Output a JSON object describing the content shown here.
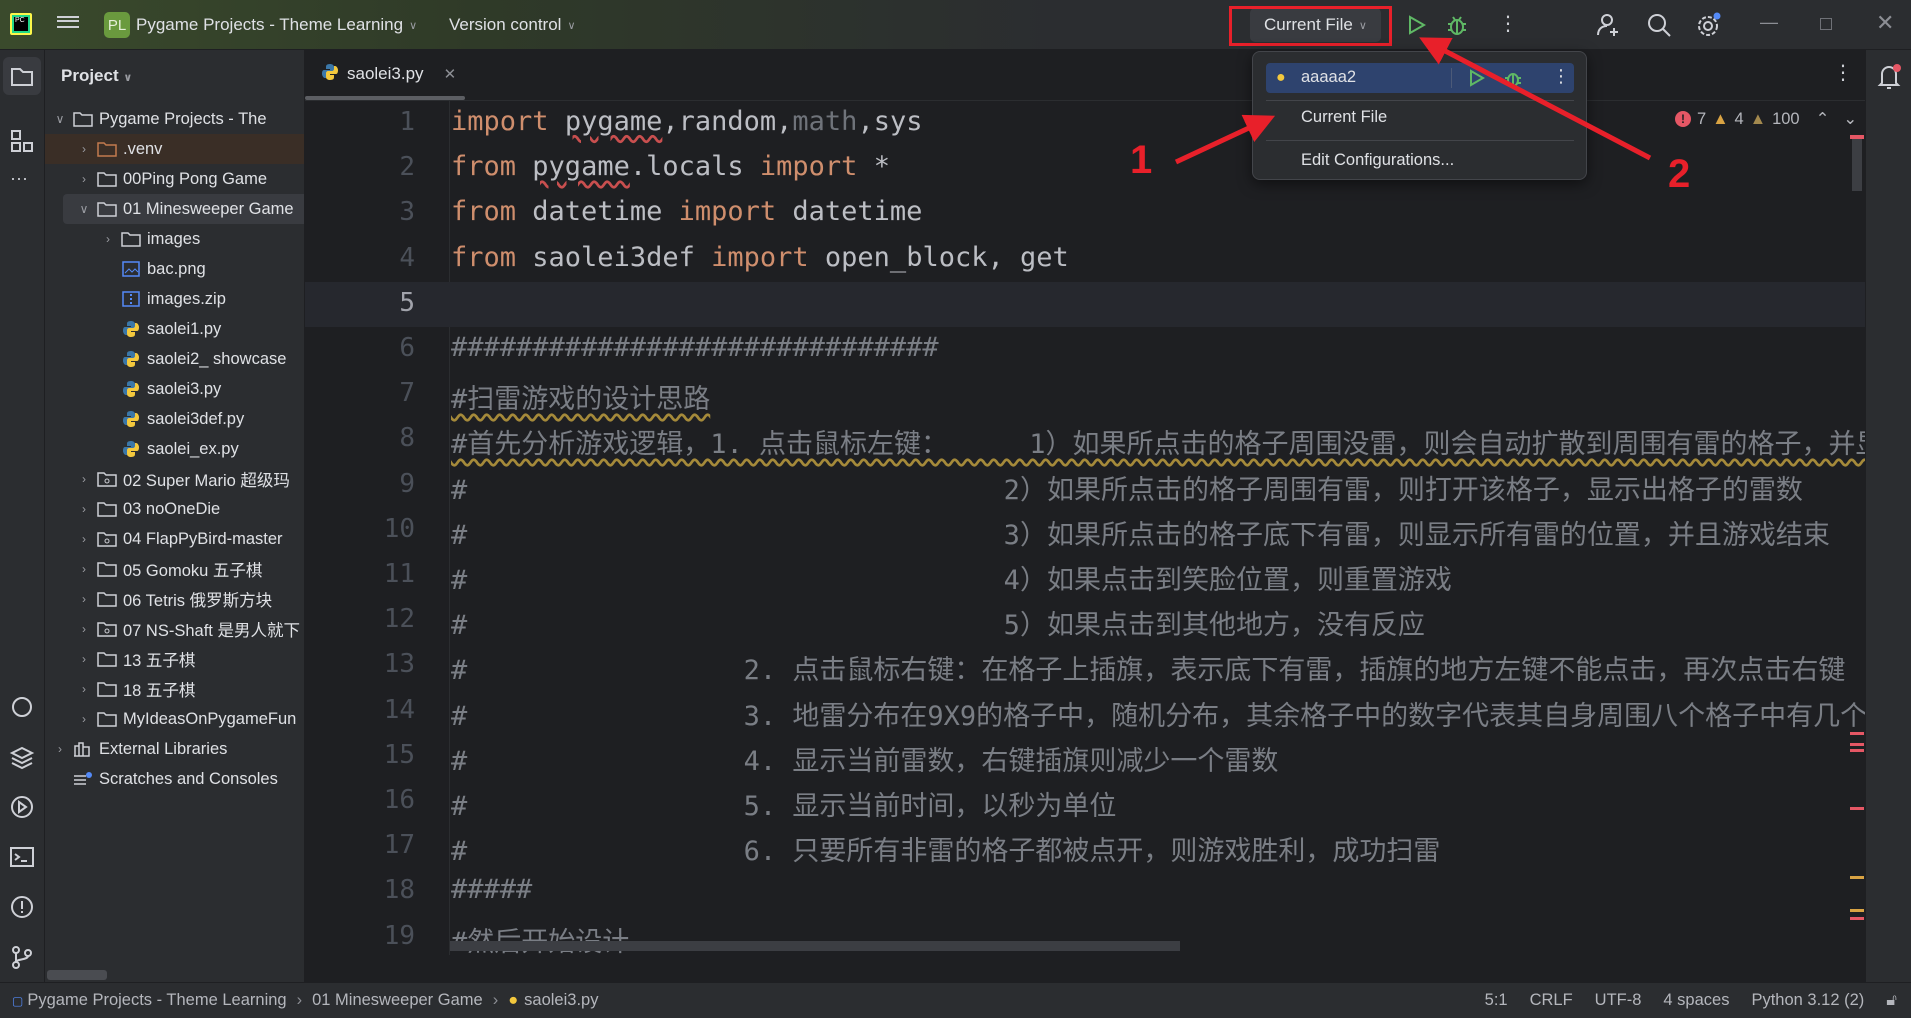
{
  "titlebar": {
    "project_badge": "PL",
    "project_name": "Pygame Projects - Theme Learning",
    "vcs": "Version control",
    "run_config": "Current File"
  },
  "project_panel": {
    "title": "Project",
    "items": [
      {
        "label": "Pygame Projects - The",
        "depth": 0,
        "arrow": "open",
        "icon": "folder"
      },
      {
        "label": ".venv",
        "depth": 1,
        "arrow": "closed",
        "icon": "folder-excluded"
      },
      {
        "label": "00Ping Pong Game",
        "depth": 1,
        "arrow": "closed",
        "icon": "folder"
      },
      {
        "label": "01 Minesweeper Game",
        "depth": 1,
        "arrow": "open",
        "icon": "folder",
        "selected": true
      },
      {
        "label": "images",
        "depth": 2,
        "arrow": "closed",
        "icon": "folder"
      },
      {
        "label": "bac.png",
        "depth": 2,
        "icon": "image"
      },
      {
        "label": "images.zip",
        "depth": 2,
        "icon": "archive"
      },
      {
        "label": "saolei1.py",
        "depth": 2,
        "icon": "python"
      },
      {
        "label": "saolei2_ showcase",
        "depth": 2,
        "icon": "python"
      },
      {
        "label": "saolei3.py",
        "depth": 2,
        "icon": "python"
      },
      {
        "label": "saolei3def.py",
        "depth": 2,
        "icon": "python"
      },
      {
        "label": "saolei_ex.py",
        "depth": 2,
        "icon": "python"
      },
      {
        "label": "02 Super Mario 超级玛",
        "depth": 1,
        "arrow": "closed",
        "icon": "folder-module"
      },
      {
        "label": "03 noOneDie",
        "depth": 1,
        "arrow": "closed",
        "icon": "folder"
      },
      {
        "label": "04 FlapPyBird-master",
        "depth": 1,
        "arrow": "closed",
        "icon": "folder-module"
      },
      {
        "label": "05 Gomoku 五子棋",
        "depth": 1,
        "arrow": "closed",
        "icon": "folder"
      },
      {
        "label": "06 Tetris 俄罗斯方块",
        "depth": 1,
        "arrow": "closed",
        "icon": "folder"
      },
      {
        "label": "07 NS-Shaft 是男人就下",
        "depth": 1,
        "arrow": "closed",
        "icon": "folder-module"
      },
      {
        "label": "13 五子棋",
        "depth": 1,
        "arrow": "closed",
        "icon": "folder"
      },
      {
        "label": "18 五子棋",
        "depth": 1,
        "arrow": "closed",
        "icon": "folder"
      },
      {
        "label": "MyIdeasOnPygameFun",
        "depth": 1,
        "arrow": "closed",
        "icon": "folder"
      },
      {
        "label": "External Libraries",
        "depth": 0,
        "arrow": "closed",
        "icon": "library"
      },
      {
        "label": "Scratches and Consoles",
        "depth": 0,
        "icon": "scratches"
      }
    ]
  },
  "tab": {
    "label": "saolei3.py"
  },
  "inspections": {
    "errors": "7",
    "warnings": "4",
    "weak_warnings": "100"
  },
  "editor": {
    "current_line": 5,
    "lines": [
      [
        {
          "t": "import",
          "c": "kw"
        },
        {
          "t": " "
        },
        {
          "t": "pygame",
          "c": "typo"
        },
        {
          "t": ",random,"
        },
        {
          "t": "math",
          "c": "dim"
        },
        {
          "t": ",sys"
        }
      ],
      [
        {
          "t": "from",
          "c": "kw"
        },
        {
          "t": " "
        },
        {
          "t": "pygame",
          "c": "typo"
        },
        {
          "t": ".locals "
        },
        {
          "t": "import",
          "c": "kw"
        },
        {
          "t": " *"
        }
      ],
      [
        {
          "t": "from",
          "c": "kw"
        },
        {
          "t": " datetime "
        },
        {
          "t": "import",
          "c": "kw"
        },
        {
          "t": " datetime"
        }
      ],
      [
        {
          "t": "from",
          "c": "kw"
        },
        {
          "t": " saolei3def "
        },
        {
          "t": "import",
          "c": "kw"
        },
        {
          "t": " open_block, get"
        }
      ],
      [],
      [
        {
          "t": "##############################",
          "c": "cm"
        }
      ],
      [
        {
          "t": "#扫雷游戏的设计思路",
          "c": "cm weak"
        }
      ],
      [
        {
          "t": "#首先分析游戏逻辑，1. 点击鼠标左键：     1）如果所点击的格子周围没雷，则会自动扩散到周围有雷的格子，并显",
          "c": "cm weak"
        }
      ],
      [
        {
          "t": "#                                 2）如果所点击的格子周围有雷，则打开该格子，显示出格子的雷数",
          "c": "cm"
        }
      ],
      [
        {
          "t": "#                                 3）如果所点击的格子底下有雷，则显示所有雷的位置，并且游戏结束",
          "c": "cm"
        }
      ],
      [
        {
          "t": "#                                 4）如果点击到笑脸位置，则重置游戏",
          "c": "cm"
        }
      ],
      [
        {
          "t": "#                                 5）如果点击到其他地方，没有反应",
          "c": "cm"
        }
      ],
      [
        {
          "t": "#                 2. 点击鼠标右键：在格子上插旗，表示底下有雷，插旗的地方左键不能点击，再次点击右键",
          "c": "cm"
        }
      ],
      [
        {
          "t": "#                 3. 地雷分布在9X9的格子中，随机分布，其余格子中的数字代表其自身周围八个格子中有几个",
          "c": "cm"
        }
      ],
      [
        {
          "t": "#                 4. 显示当前雷数，右键插旗则减少一个雷数",
          "c": "cm"
        }
      ],
      [
        {
          "t": "#                 5. 显示当前时间，以秒为单位",
          "c": "cm"
        }
      ],
      [
        {
          "t": "#                 6. 只要所有非雷的格子都被点开，则游戏胜利，成功扫雷",
          "c": "cm"
        }
      ],
      [
        {
          "t": "#####",
          "c": "cm"
        }
      ],
      [
        {
          "t": "#然后开始设计",
          "c": "cm dot"
        }
      ]
    ]
  },
  "run_popup": {
    "pinned": "aaaaa2",
    "items": [
      "Current File",
      "Edit Configurations..."
    ]
  },
  "annotations": {
    "label1": "1",
    "label2": "2",
    "color": "#e8202a"
  },
  "statusbar": {
    "breadcrumb": [
      "Pygame Projects - Theme Learning",
      "01 Minesweeper Game",
      "saolei3.py"
    ],
    "position": "5:1",
    "line_sep": "CRLF",
    "encoding": "UTF-8",
    "indent": "4 spaces",
    "interpreter": "Python 3.12 (2)"
  },
  "colors": {
    "keyword": "#cf8e6d",
    "comment": "#7a7e85",
    "text": "#bcbec4",
    "run_green": "#5fb865",
    "error": "#e55765",
    "warning": "#d9a343"
  }
}
